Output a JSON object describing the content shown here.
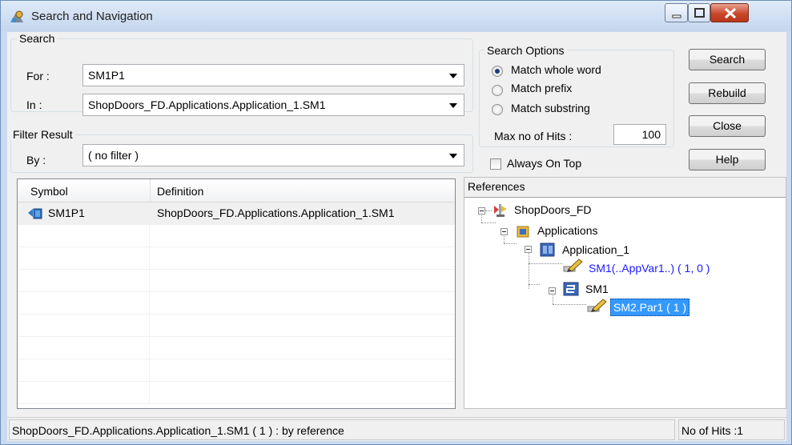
{
  "window": {
    "title": "Search and Navigation",
    "controls": {
      "minimize": "minimize",
      "maximize": "maximize",
      "close": "close"
    }
  },
  "search": {
    "group_label": "Search",
    "for_label": "For :",
    "for_value": "SM1P1",
    "in_label": "In :",
    "in_value": "ShopDoors_FD.Applications.Application_1.SM1"
  },
  "filter": {
    "group_label": "Filter Result",
    "by_label": "By :",
    "by_value": "( no filter )"
  },
  "options": {
    "group_label": "Search Options",
    "radios": [
      {
        "label": "Match whole word",
        "selected": true
      },
      {
        "label": "Match prefix",
        "selected": false
      },
      {
        "label": "Match substring",
        "selected": false
      }
    ],
    "max_hits_label": "Max no of Hits :",
    "max_hits_value": "100",
    "always_on_top_label": "Always On Top",
    "always_on_top_checked": false
  },
  "buttons": {
    "search": "Search",
    "rebuild": "Rebuild",
    "close": "Close",
    "help": "Help"
  },
  "results": {
    "columns": [
      "Symbol",
      "Definition"
    ],
    "rows": [
      {
        "symbol": "SM1P1",
        "definition": "ShopDoors_FD.Applications.Application_1.SM1"
      }
    ]
  },
  "references": {
    "label": "References",
    "tree": {
      "root": "ShopDoors_FD",
      "applications": "Applications",
      "application_1": "Application_1",
      "sm1_ref": "SM1(..AppVar1..) ( 1, 0 )",
      "sm1": "SM1",
      "sm2_ref": "SM2.Par1 ( 1 )"
    }
  },
  "status": {
    "left": "ShopDoors_FD.Applications.Application_1.SM1 ( 1 ) : by reference",
    "right": "No of Hits :1"
  },
  "colors": {
    "selection": "#3399ff",
    "link_blue": "#1a1aff",
    "title_bg": "#c9daf1"
  }
}
